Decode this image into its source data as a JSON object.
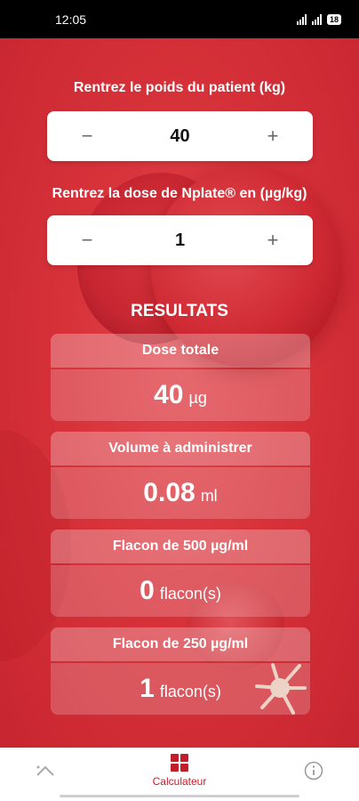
{
  "status_bar": {
    "time": "12:05",
    "battery": "18"
  },
  "weight": {
    "label": "Rentrez le poids du patient (kg)",
    "value": "40",
    "minus": "−",
    "plus": "+"
  },
  "dose": {
    "label": "Rentrez la dose de Nplate® en (µg/kg)",
    "value": "1",
    "minus": "−",
    "plus": "+"
  },
  "results": {
    "title": "RESULTATS",
    "items": [
      {
        "label": "Dose totale",
        "value": "40",
        "unit": "µg"
      },
      {
        "label": "Volume à administrer",
        "value": "0.08",
        "unit": "ml"
      },
      {
        "label": "Flacon de 500 µg/ml",
        "value": "0",
        "unit": "flacon(s)"
      },
      {
        "label": "Flacon de 250 µg/ml",
        "value": "1",
        "unit": "flacon(s)"
      }
    ]
  },
  "nav": {
    "calculator_label": "Calculateur"
  },
  "colors": {
    "accent": "#c21f2b",
    "background": "#d7323a"
  }
}
